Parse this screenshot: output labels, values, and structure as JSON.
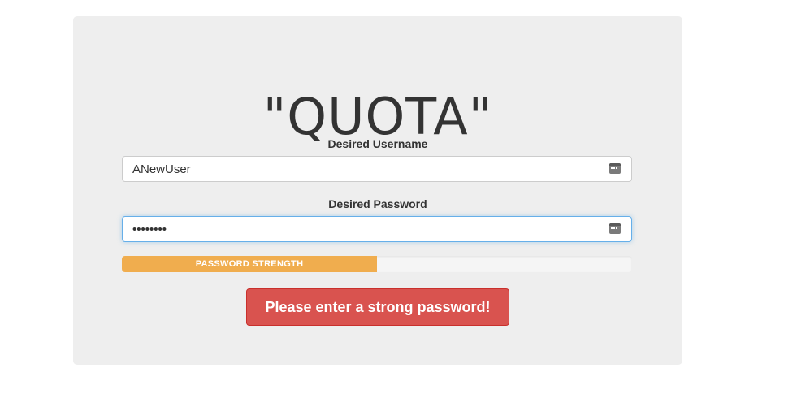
{
  "form": {
    "title": "\"QUOTA\"",
    "username": {
      "label": "Desired Username",
      "value": "ANewUser",
      "icon": "password-manager-icon"
    },
    "password": {
      "label": "Desired Password",
      "value": "••••••••",
      "icon": "password-manager-icon"
    },
    "strength": {
      "label": "PASSWORD STRENGTH",
      "percent": 50,
      "color": "#f0ad4e"
    },
    "submit_label": "Please enter a strong password!"
  },
  "colors": {
    "panel": "#eeeeee",
    "button": "#d9534f",
    "focus": "#66afe9"
  }
}
